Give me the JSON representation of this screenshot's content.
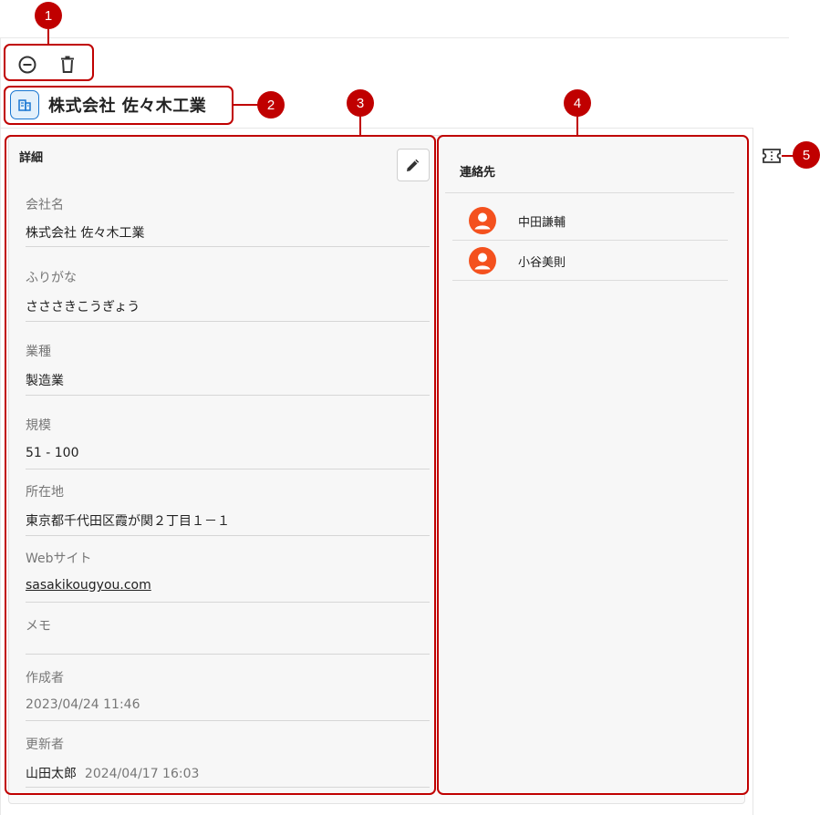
{
  "callouts": [
    "1",
    "2",
    "3",
    "4",
    "5"
  ],
  "toolbar": {
    "remove_icon": "minus-circle-icon",
    "delete_icon": "trash-icon"
  },
  "header": {
    "title": "株式会社 佐々木工業",
    "icon": "building-icon"
  },
  "details": {
    "title": "詳細",
    "edit_icon": "pencil-icon",
    "fields": {
      "company_name": {
        "label": "会社名",
        "value": "株式会社 佐々木工業"
      },
      "furigana": {
        "label": "ふりがな",
        "value": "さささきこうぎょう"
      },
      "industry": {
        "label": "業種",
        "value": "製造業"
      },
      "size": {
        "label": "規模",
        "value": "51 - 100"
      },
      "address": {
        "label": "所在地",
        "value": "東京都千代田区霞が関２丁目１－１"
      },
      "website": {
        "label": "Webサイト",
        "value": "sasakikougyou.com"
      },
      "memo": {
        "label": "メモ",
        "value": ""
      },
      "created_by": {
        "label": "作成者",
        "user": "",
        "timestamp": "2023/04/24 11:46"
      },
      "updated_by": {
        "label": "更新者",
        "user": "山田太郎",
        "timestamp": "2024/04/17 16:03"
      }
    }
  },
  "contacts": {
    "title": "連絡先",
    "items": [
      {
        "name": "中田謙輔",
        "icon": "person-icon"
      },
      {
        "name": "小谷美則",
        "icon": "person-icon"
      }
    ]
  },
  "side": {
    "ticket_icon": "ticket-icon"
  },
  "colors": {
    "callout": "#c00000",
    "avatar": "#f4511e",
    "accent": "#1976d2"
  }
}
